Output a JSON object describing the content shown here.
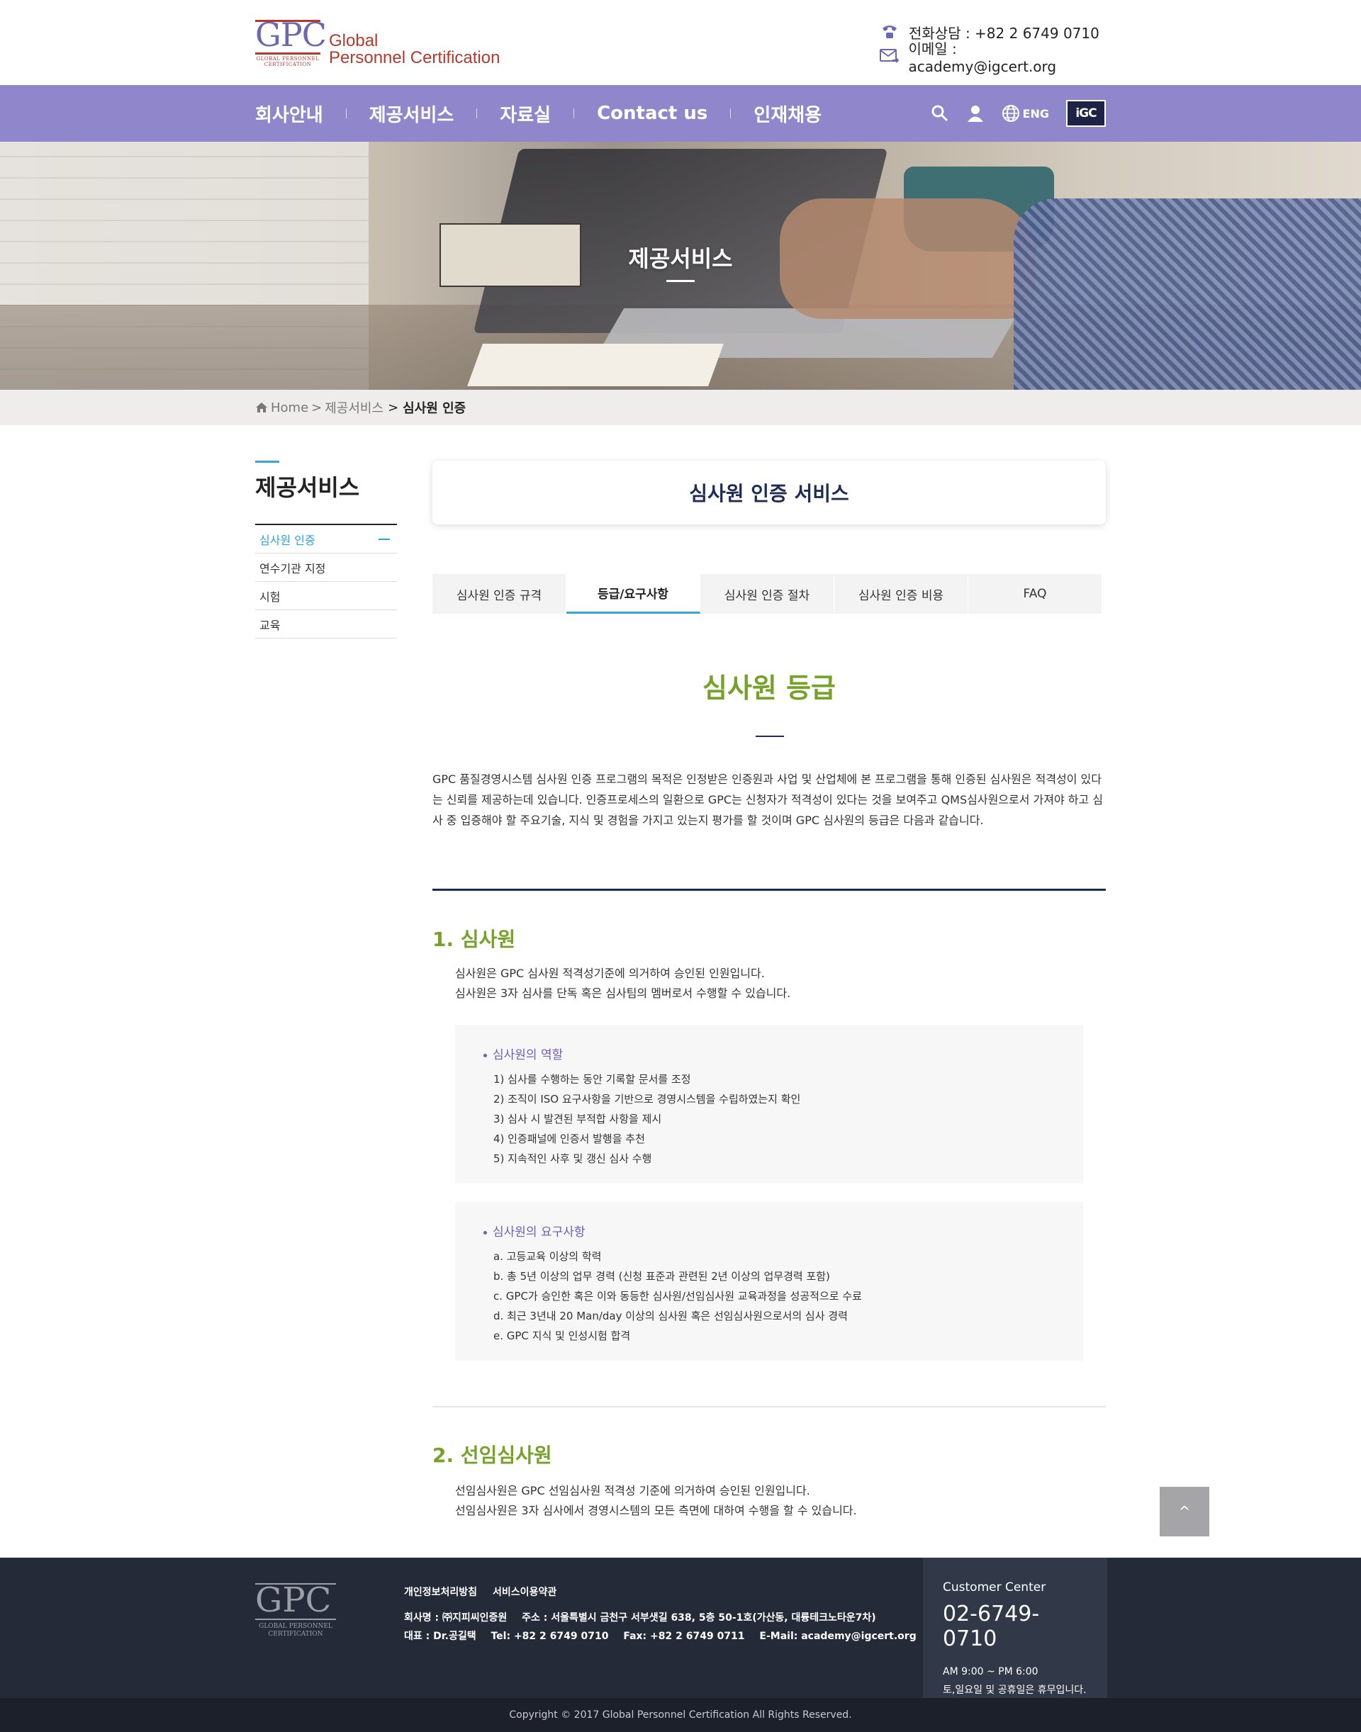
{
  "header": {
    "logo_mark": "GPC",
    "logo_sub": "GLOBAL PERSONNEL CERTIFICATION",
    "logo_line1": "Global",
    "logo_line2": "Personnel Certification",
    "phone_text": "전화상담 : +82 2 6749 0710",
    "email_text": "이메일 : academy@igcert.org"
  },
  "nav": {
    "items": [
      "회사안내",
      "제공서비스",
      "자료실",
      "Contact us",
      "인재채용"
    ],
    "lang_label": "ENG",
    "igc_label": "iGC"
  },
  "hero": {
    "title": "제공서비스"
  },
  "breadcrumb": {
    "home": "Home",
    "level1": "제공서비스",
    "current": "심사원 인증",
    "sep": ">"
  },
  "sidebar": {
    "title": "제공서비스",
    "items": [
      "심사원 인증",
      "연수기관 지정",
      "시험",
      "교육"
    ]
  },
  "content": {
    "card_title": "심사원 인증 서비스",
    "tabs": [
      "심사원 인증 규격",
      "등급/요구사항",
      "심사원 인증 절차",
      "심사원 인증 비용",
      "FAQ"
    ],
    "active_tab": "등급/요구사항",
    "section_title": "심사원 등급",
    "intro": "GPC 품질경영시스템 심사원 인증 프로그램의 목적은 인정받은 인증원과 사업 및 산업체에 본 프로그램을 통해 인증된 심사원은 적격성이 있다는 신뢰를 제공하는데 있습니다. 인증프로세스의 일환으로 GPC는 신청자가 적격성이 있다는 것을 보여주고 QMS심사원으로서 가져야 하고 심사 중 입증해야 할  주요기술, 지식 및 경험을 가지고 있는지 평가를 할 것이며 GPC 심사원의 등급은 다음과 같습니다.",
    "auditor": {
      "heading": "1. 심사원",
      "desc1": "심사원은 GPC 심사원 적격성기준에 의거하여 승인된 인원입니다.",
      "desc2": "심사원은 3자 심사를 단독 혹은 심사팀의 멤버로서 수행할 수 있습니다.",
      "role_title": "심사원의 역할",
      "roles": [
        "1) 심사를 수행하는 동안 기록할 문서를 조정",
        "2) 조직이 ISO 요구사항을 기반으로 경영시스템을 수립하였는지 확인",
        "3) 심사 시 발견된 부적합 사항을 제시",
        "4) 인증패널에 인증서 발행을 추천",
        "5) 지속적인 사후 및 갱신 심사 수행"
      ],
      "req_title": "심사원의 요구사항",
      "reqs": [
        "a. 고등교육 이상의 학력",
        "b. 총 5년 이상의 업무 경력 (신청 표준과 관련된 2년 이상의 업무경력 포함)",
        "c. GPC가 승인한 혹은 이와 동등한 심사원/선임심사원 교육과정을 성공적으로 수료",
        "d. 최근 3년내 20 Man/day 이상의 심사원 혹은 선임심사원으로서의 심사 경력",
        "e. GPC 지식 및 인성시험 합격"
      ]
    },
    "lead_auditor": {
      "heading": "2. 선임심사원",
      "desc1": "선임심사원은 GPC 선임심사원 적격성 기준에 의거하여 승인된 인원입니다.",
      "desc2": "선임심사원은 3자 심사에서 경영시스템의 모든 측면에 대하여 수행을 할 수 있습니다."
    }
  },
  "top_button": "^",
  "footer": {
    "logo_mark": "GPC",
    "logo_sub": "GLOBAL PERSONNEL CERTIFICATION",
    "links": [
      "개인정보처리방침",
      "서비스이용약관"
    ],
    "company": "회사명 : ㈜지피씨인증원",
    "address": "주소 : 서울특별시 금천구 서부샛길 638, 5층 50-1호(가산동, 대륭테크노타운7차)",
    "ceo": "대표 : Dr.공길택",
    "tel": "Tel: +82 2 6749 0710",
    "fax": "Fax: +82 2 6749 0711",
    "email": "E-Mail: academy@igcert.org",
    "cc_label": "Customer Center",
    "cc_phone": "02-6749-0710",
    "cc_hours1": "AM 9:00 ~ PM 6:00",
    "cc_hours2": "토,일요일 및 공휴일은 휴무입니다.",
    "copyright": "Copyright © 2017 Global Personnel Certification All Rights Reserved."
  },
  "colors": {
    "nav_bg": "#8f86cc",
    "accent_green": "#76a22a",
    "accent_blue": "#3aa3d8",
    "accent_purple": "#6b5fb7",
    "brand_red": "#b23a2f",
    "footer_bg": "#242a37"
  }
}
